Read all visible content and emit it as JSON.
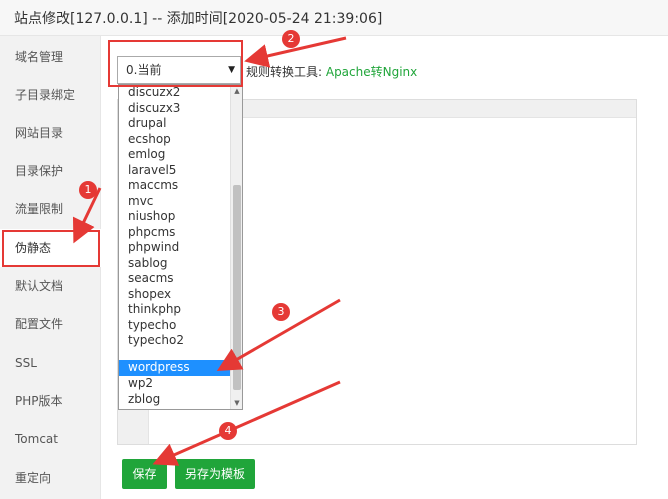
{
  "window": {
    "title": "站点修改[127.0.0.1] -- 添加时间[2020-05-24 21:39:06]"
  },
  "sidebar": {
    "items": [
      {
        "label": "域名管理"
      },
      {
        "label": "子目录绑定"
      },
      {
        "label": "网站目录"
      },
      {
        "label": "目录保护"
      },
      {
        "label": "流量限制"
      },
      {
        "label": "伪静态",
        "active": true
      },
      {
        "label": "默认文档"
      },
      {
        "label": "配置文件"
      },
      {
        "label": "SSL"
      },
      {
        "label": "PHP版本"
      },
      {
        "label": "Tomcat"
      },
      {
        "label": "重定向"
      }
    ]
  },
  "rewrite": {
    "selected_value": "0.当前",
    "tool_label": "规则转换工具: ",
    "tool_link": "Apache转Nginx",
    "options": [
      "discuzx2",
      "discuzx3",
      "drupal",
      "ecshop",
      "emlog",
      "laravel5",
      "maccms",
      "mvc",
      "niushop",
      "phpcms",
      "phpwind",
      "sablog",
      "seacms",
      "shopex",
      "thinkphp",
      "typecho",
      "typecho2",
      "wordpress",
      "wp2",
      "zblog"
    ],
    "highlighted_option": "wordpress"
  },
  "buttons": {
    "save": "保存",
    "save_as_template": "另存为模板"
  },
  "annotations": {
    "markers": [
      "1",
      "2",
      "3",
      "4"
    ],
    "color": "#e53935"
  },
  "colors": {
    "accent_green": "#20a53a",
    "selection_blue": "#1e90ff"
  }
}
